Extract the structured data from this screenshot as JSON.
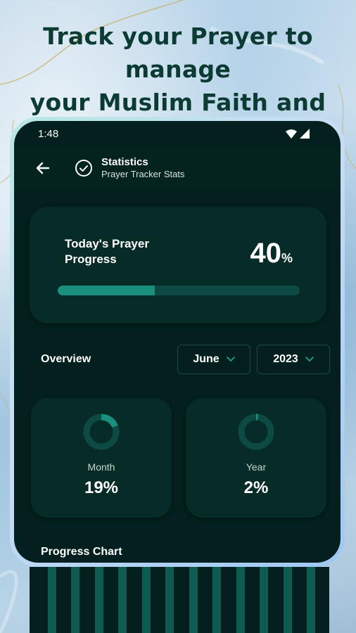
{
  "headline": {
    "line1": "Track your Prayer to manage",
    "line2": "your Muslim Faith and Practice"
  },
  "status_bar": {
    "time": "1:48",
    "icons": [
      "wifi-icon",
      "signal-icon"
    ]
  },
  "app_bar": {
    "back_icon": "arrow-left-icon",
    "title_icon": "check-circle-icon",
    "title": "Statistics",
    "subtitle": "Prayer Tracker Stats"
  },
  "today_progress": {
    "label": "Today's Prayer Progress",
    "value": "40",
    "unit": "%",
    "fraction": 0.4
  },
  "overview": {
    "label": "Overview",
    "month_select": "June",
    "year_select": "2023",
    "dropdown_icon": "chevron-down-icon"
  },
  "stats": [
    {
      "label": "Month",
      "value": "19%",
      "fraction": 0.19
    },
    {
      "label": "Year",
      "value": "2%",
      "fraction": 0.02
    }
  ],
  "progress_chart": {
    "title": "Progress Chart"
  },
  "colors": {
    "screen_bg": "#03201e",
    "card_bg": "#072c28",
    "accent": "#1a8f7d",
    "track": "#0d4a43",
    "headline": "#0c3b33"
  }
}
